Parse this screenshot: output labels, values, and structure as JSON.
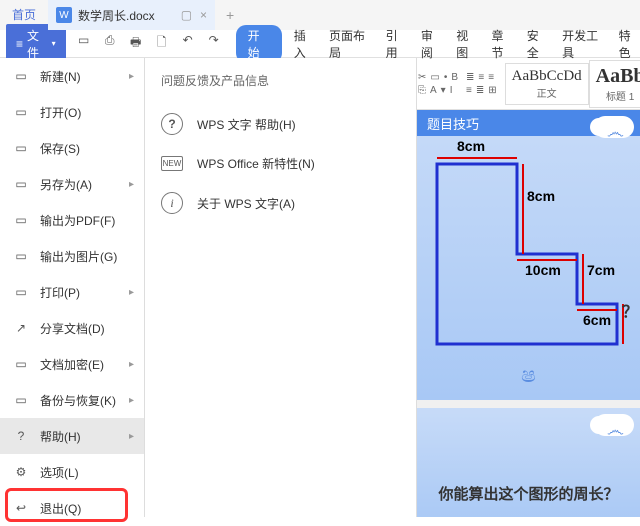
{
  "tabs": {
    "home": "首页",
    "doc_title": "数学周长.docx",
    "doc_icon": "W",
    "add": "+"
  },
  "file_button": "文件",
  "ribbon": {
    "start": "开始",
    "tabs": [
      "插入",
      "页面布局",
      "引用",
      "审阅",
      "视图",
      "章节",
      "安全",
      "开发工具",
      "特色"
    ],
    "style1_sample": "AaBbCcDd",
    "style1_name": "正文",
    "style2_sample": "AaBb",
    "style2_name": "标题 1"
  },
  "file_menu": [
    {
      "icon": "▭",
      "label": "新建(N)",
      "arrow": true
    },
    {
      "icon": "▭",
      "label": "打开(O)"
    },
    {
      "icon": "▭",
      "label": "保存(S)"
    },
    {
      "icon": "▭",
      "label": "另存为(A)",
      "arrow": true
    },
    {
      "icon": "▭",
      "label": "输出为PDF(F)"
    },
    {
      "icon": "▭",
      "label": "输出为图片(G)"
    },
    {
      "icon": "▭",
      "label": "打印(P)",
      "arrow": true
    },
    {
      "icon": "↗",
      "label": "分享文档(D)"
    },
    {
      "icon": "▭",
      "label": "文档加密(E)",
      "arrow": true
    },
    {
      "icon": "▭",
      "label": "备份与恢复(K)",
      "arrow": true
    },
    {
      "icon": "?",
      "label": "帮助(H)",
      "arrow": true,
      "hover": true
    },
    {
      "icon": "⚙",
      "label": "选项(L)"
    },
    {
      "icon": "↩",
      "label": "退出(Q)"
    }
  ],
  "submenu": {
    "header": "问题反馈及产品信息",
    "items": [
      {
        "type": "q",
        "label": "WPS 文字 帮助(H)"
      },
      {
        "type": "n",
        "badge": "NEW",
        "label": "WPS Office 新特性(N)"
      },
      {
        "type": "i",
        "label": "关于 WPS 文字(A)"
      }
    ]
  },
  "slide1": {
    "title_suffix": "题目技巧",
    "labels": {
      "t": "8cm",
      "r1": "8cm",
      "mid": "10cm",
      "r2": "7cm",
      "b": "6cm"
    }
  },
  "slide2": {
    "question": "你能算出这个图形的周长？"
  },
  "qmark": "？"
}
